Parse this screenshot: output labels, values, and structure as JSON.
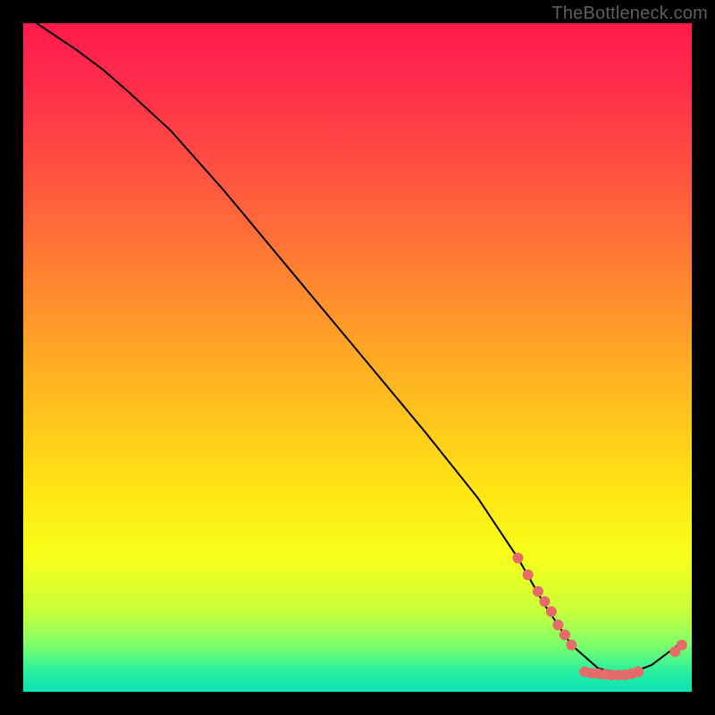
{
  "watermark": "TheBottleneck.com",
  "chart_data": {
    "type": "line",
    "title": "",
    "xlabel": "",
    "ylabel": "",
    "xlim": [
      0,
      100
    ],
    "ylim": [
      0,
      100
    ],
    "series": [
      {
        "name": "curve",
        "x": [
          2,
          5,
          8,
          12,
          16,
          22,
          30,
          40,
          50,
          60,
          68,
          74,
          78,
          82,
          86,
          90,
          94,
          98
        ],
        "values": [
          100,
          98,
          96,
          93,
          89.5,
          84,
          75,
          63,
          51,
          39,
          29,
          20,
          13,
          7,
          3.5,
          2.5,
          4,
          7
        ]
      }
    ],
    "markers": [
      {
        "x": 74.0,
        "y": 20.0
      },
      {
        "x": 75.5,
        "y": 17.5
      },
      {
        "x": 77.0,
        "y": 15.0
      },
      {
        "x": 78.0,
        "y": 13.5
      },
      {
        "x": 79.0,
        "y": 12.0
      },
      {
        "x": 80.0,
        "y": 10.0
      },
      {
        "x": 81.0,
        "y": 8.5
      },
      {
        "x": 82.0,
        "y": 7.0
      },
      {
        "x": 84.0,
        "y": 3.0
      },
      {
        "x": 85.0,
        "y": 2.8
      },
      {
        "x": 86.0,
        "y": 2.7
      },
      {
        "x": 87.0,
        "y": 2.6
      },
      {
        "x": 88.0,
        "y": 2.5
      },
      {
        "x": 89.0,
        "y": 2.5
      },
      {
        "x": 90.0,
        "y": 2.5
      },
      {
        "x": 91.0,
        "y": 2.7
      },
      {
        "x": 92.0,
        "y": 3.0
      },
      {
        "x": 97.5,
        "y": 6.0
      },
      {
        "x": 98.5,
        "y": 7.0
      }
    ],
    "marker_color": "#e56a6a",
    "curve_color": "#000000"
  }
}
